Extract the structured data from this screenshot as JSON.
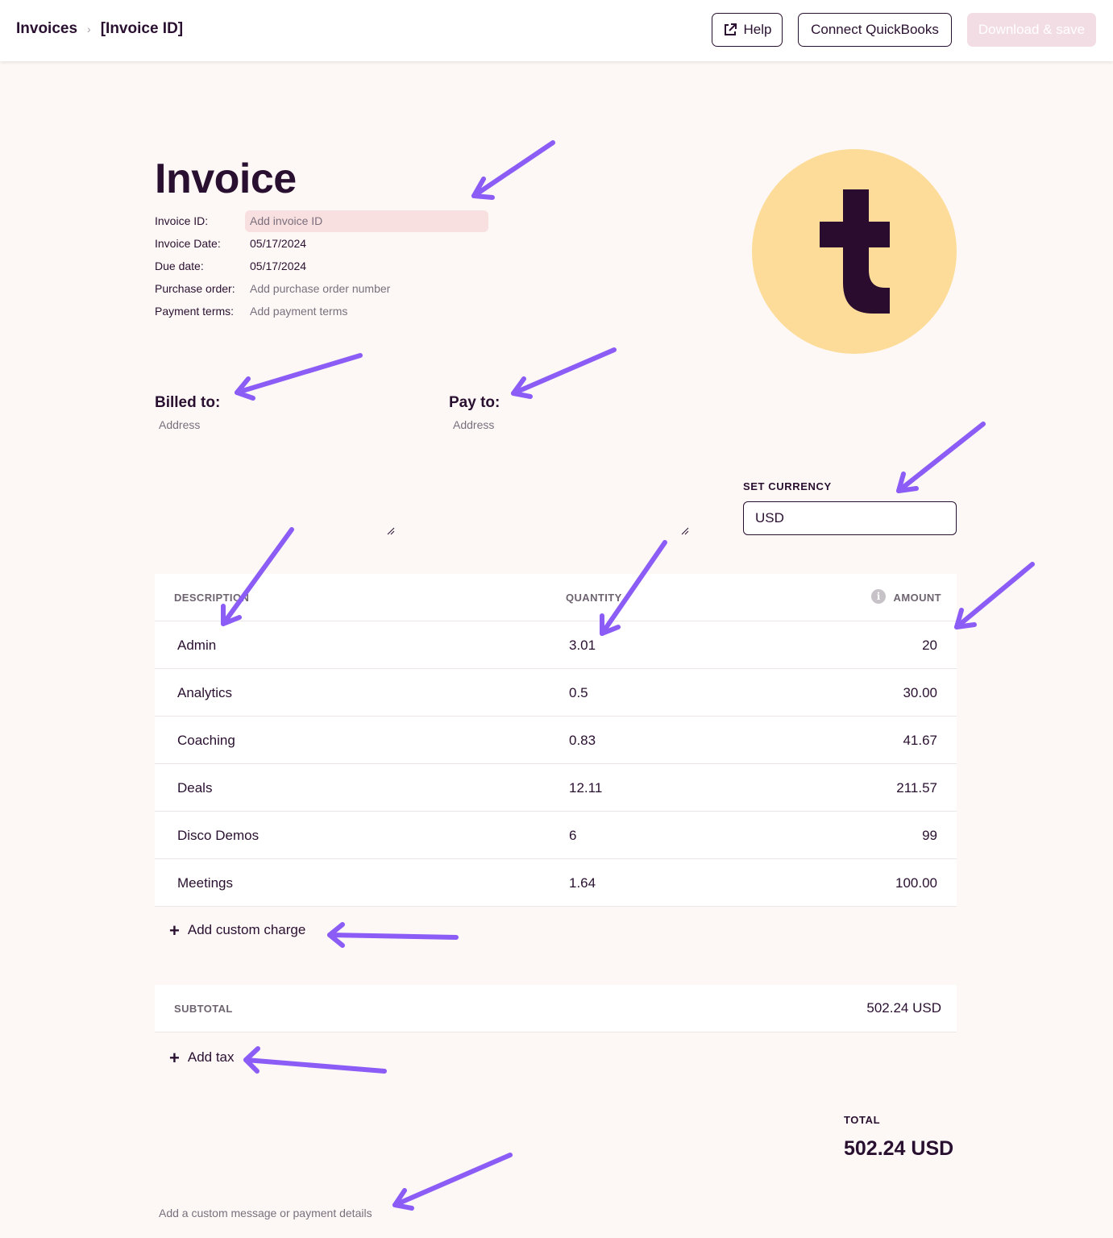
{
  "breadcrumb": {
    "parent": "Invoices",
    "current": "[Invoice ID]"
  },
  "toolbar": {
    "help_label": "Help",
    "quickbooks_label": "Connect QuickBooks",
    "download_label": "Download & save"
  },
  "invoice": {
    "title": "Invoice",
    "fields": {
      "id_label": "Invoice ID:",
      "id_placeholder": "Add invoice ID",
      "date_label": "Invoice Date:",
      "date_value": "05/17/2024",
      "due_label": "Due date:",
      "due_value": "05/17/2024",
      "po_label": "Purchase order:",
      "po_placeholder": "Add purchase order number",
      "terms_label": "Payment terms:",
      "terms_placeholder": "Add payment terms"
    },
    "logo_letter": "t"
  },
  "billed_to": {
    "heading": "Billed to:",
    "placeholder": "Address"
  },
  "pay_to": {
    "heading": "Pay to:",
    "placeholder": "Address"
  },
  "currency": {
    "label": "SET CURRENCY",
    "value": "USD"
  },
  "table": {
    "headers": {
      "description": "DESCRIPTION",
      "quantity": "QUANTITY",
      "amount": "AMOUNT"
    },
    "rows": [
      {
        "description": "Admin",
        "quantity": "3.01",
        "amount": "20"
      },
      {
        "description": "Analytics",
        "quantity": "0.5",
        "amount": "30.00"
      },
      {
        "description": "Coaching",
        "quantity": "0.83",
        "amount": "41.67"
      },
      {
        "description": "Deals",
        "quantity": "12.11",
        "amount": "211.57"
      },
      {
        "description": "Disco Demos",
        "quantity": "6",
        "amount": "99"
      },
      {
        "description": "Meetings",
        "quantity": "1.64",
        "amount": "100.00"
      }
    ]
  },
  "add_charge_label": "Add custom charge",
  "subtotal": {
    "label": "SUBTOTAL",
    "value": "502.24 USD"
  },
  "add_tax_label": "Add tax",
  "total": {
    "label": "TOTAL",
    "value": "502.24 USD"
  },
  "message_placeholder": "Add a custom message or payment details",
  "colors": {
    "background": "#fdf8f5",
    "text": "#2a1030",
    "logo_circle": "#fcdc98",
    "annotation_arrow": "#8b5cf6",
    "download_button": "#f3dde4"
  }
}
